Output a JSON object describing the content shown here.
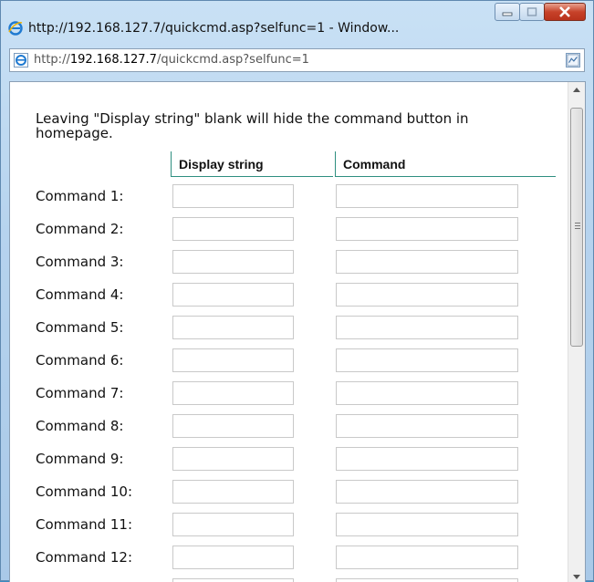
{
  "window": {
    "title": "http://192.168.127.7/quickcmd.asp?selfunc=1 - Window...",
    "minimize_label": "",
    "maximize_label": "",
    "close_label": ""
  },
  "address": {
    "prefix": "http://",
    "host": "192.168.127.7",
    "path": "/quickcmd.asp?selfunc=1"
  },
  "page": {
    "note": "Leaving \"Display string\" blank will hide the command button in homepage.",
    "col_display": "Display string",
    "col_command": "Command",
    "rows": [
      {
        "label": "Command 1:",
        "display": "",
        "command": ""
      },
      {
        "label": "Command 2:",
        "display": "",
        "command": ""
      },
      {
        "label": "Command 3:",
        "display": "",
        "command": ""
      },
      {
        "label": "Command 4:",
        "display": "",
        "command": ""
      },
      {
        "label": "Command 5:",
        "display": "",
        "command": ""
      },
      {
        "label": "Command 6:",
        "display": "",
        "command": ""
      },
      {
        "label": "Command 7:",
        "display": "",
        "command": ""
      },
      {
        "label": "Command 8:",
        "display": "",
        "command": ""
      },
      {
        "label": "Command 9:",
        "display": "",
        "command": ""
      },
      {
        "label": "Command 10:",
        "display": "",
        "command": ""
      },
      {
        "label": "Command 11:",
        "display": "",
        "command": ""
      },
      {
        "label": "Command 12:",
        "display": "",
        "command": ""
      },
      {
        "label": "",
        "display": "",
        "command": ""
      }
    ]
  },
  "colors": {
    "accent": "#2e8f80",
    "chrome": "#b6d3ee",
    "close": "#c7432a"
  }
}
